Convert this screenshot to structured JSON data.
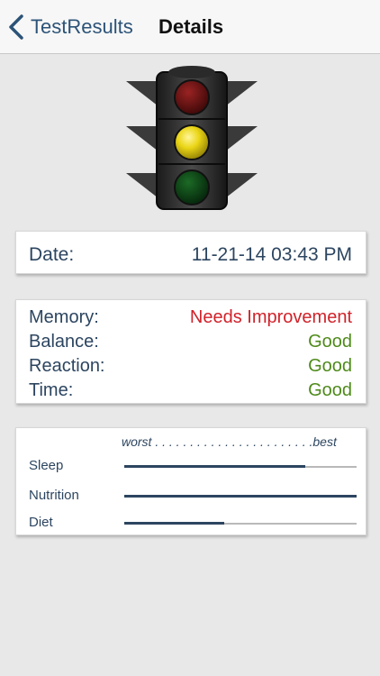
{
  "nav": {
    "back_label": "TestResults",
    "title": "Details"
  },
  "traffic_light": {
    "icon": "traffic-light-icon",
    "active": "yellow",
    "colors": {
      "red": "#6b0f0f",
      "yellow": "#e3cf10",
      "green": "#0b3d12"
    }
  },
  "date_card": {
    "label": "Date:",
    "value": "11-21-14 03:43 PM"
  },
  "results": [
    {
      "label": "Memory:",
      "value": "Needs Improvement",
      "color": "#d0222a"
    },
    {
      "label": "Balance:",
      "value": "Good",
      "color": "#4e8a1a"
    },
    {
      "label": "Reaction:",
      "value": "Good",
      "color": "#4e8a1a"
    },
    {
      "label": "Time:",
      "value": "Good",
      "color": "#4e8a1a"
    }
  ],
  "lifestyle": {
    "scale_label": "worst . . . . . . . . . . . . . . . . . . . . . . .best",
    "items": [
      {
        "label": "Sleep",
        "level": 0.78
      },
      {
        "label": "Nutrition",
        "level": 1.0
      },
      {
        "label": "Diet",
        "level": 0.43
      }
    ]
  },
  "colors": {
    "accent": "#2c5378",
    "text": "#2c4560",
    "background": "#e8e8e8"
  }
}
